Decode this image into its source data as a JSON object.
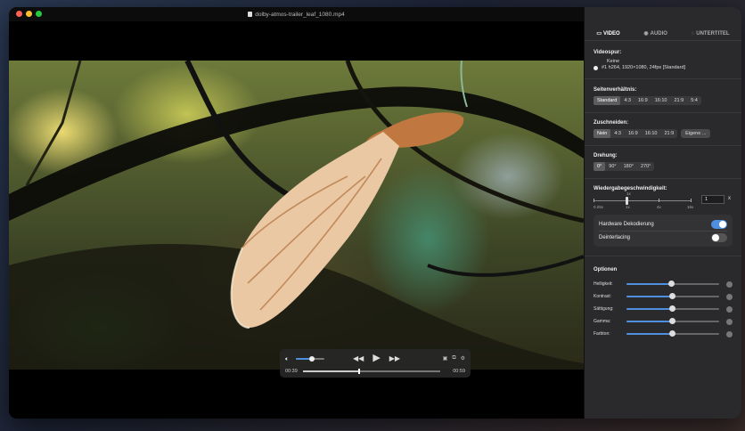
{
  "window": {
    "title": "dolby-atmos-trailer_leaf_1080.mp4",
    "lights": {
      "close": "#fe5f57",
      "minimize": "#febc2e",
      "zoom": "#28c840"
    }
  },
  "player": {
    "time_elapsed": "00:39",
    "time_remaining": "00:59",
    "volume_level": 0.55,
    "progress": 0.4
  },
  "panel": {
    "tabs": [
      {
        "label": "VIDEO",
        "icon": "film-icon",
        "active": true
      },
      {
        "label": "AUDIO",
        "icon": "speaker-icon",
        "active": false
      },
      {
        "label": "UNTERTITEL",
        "icon": "subtitle-icon",
        "active": false
      }
    ],
    "videospur": {
      "label": "Videospur:",
      "none_option": "Keine",
      "track_line": "#1  h264, 1920×1080, 24fps [Standard]"
    },
    "seitenverhaeltnis": {
      "label": "Seitenverhältnis:",
      "options": [
        "Standard",
        "4:3",
        "16:9",
        "16:10",
        "21:9",
        "5:4"
      ],
      "selected": 0
    },
    "zuschneiden": {
      "label": "Zuschneiden:",
      "options": [
        "Nein",
        "4:3",
        "16:9",
        "16:10",
        "21:9"
      ],
      "selected": 0,
      "custom_button": "Eigene ..."
    },
    "drehung": {
      "label": "Drehung:",
      "options": [
        "0°",
        "90°",
        "180°",
        "270°"
      ],
      "selected": 0
    },
    "speed": {
      "label": "Wiedergabegeschwindigkeit:",
      "marker": "1x",
      "ticks": [
        "0.25x",
        "1x",
        "4x",
        "16x"
      ],
      "value": "1",
      "unit": "x"
    },
    "toggles": [
      {
        "label": "Hardware Dekodierung",
        "on": true
      },
      {
        "label": "Deinterlacing",
        "on": false
      }
    ],
    "optionen": {
      "label": "Optionen",
      "items": [
        {
          "name": "Helligkeit:",
          "level": 0.48
        },
        {
          "name": "Kontrast:",
          "level": 0.49
        },
        {
          "name": "Sättigung:",
          "level": 0.49
        },
        {
          "name": "Gamma:",
          "level": 0.49
        },
        {
          "name": "Farbton:",
          "level": 0.49
        }
      ]
    }
  },
  "accent": "#4f8fe0"
}
